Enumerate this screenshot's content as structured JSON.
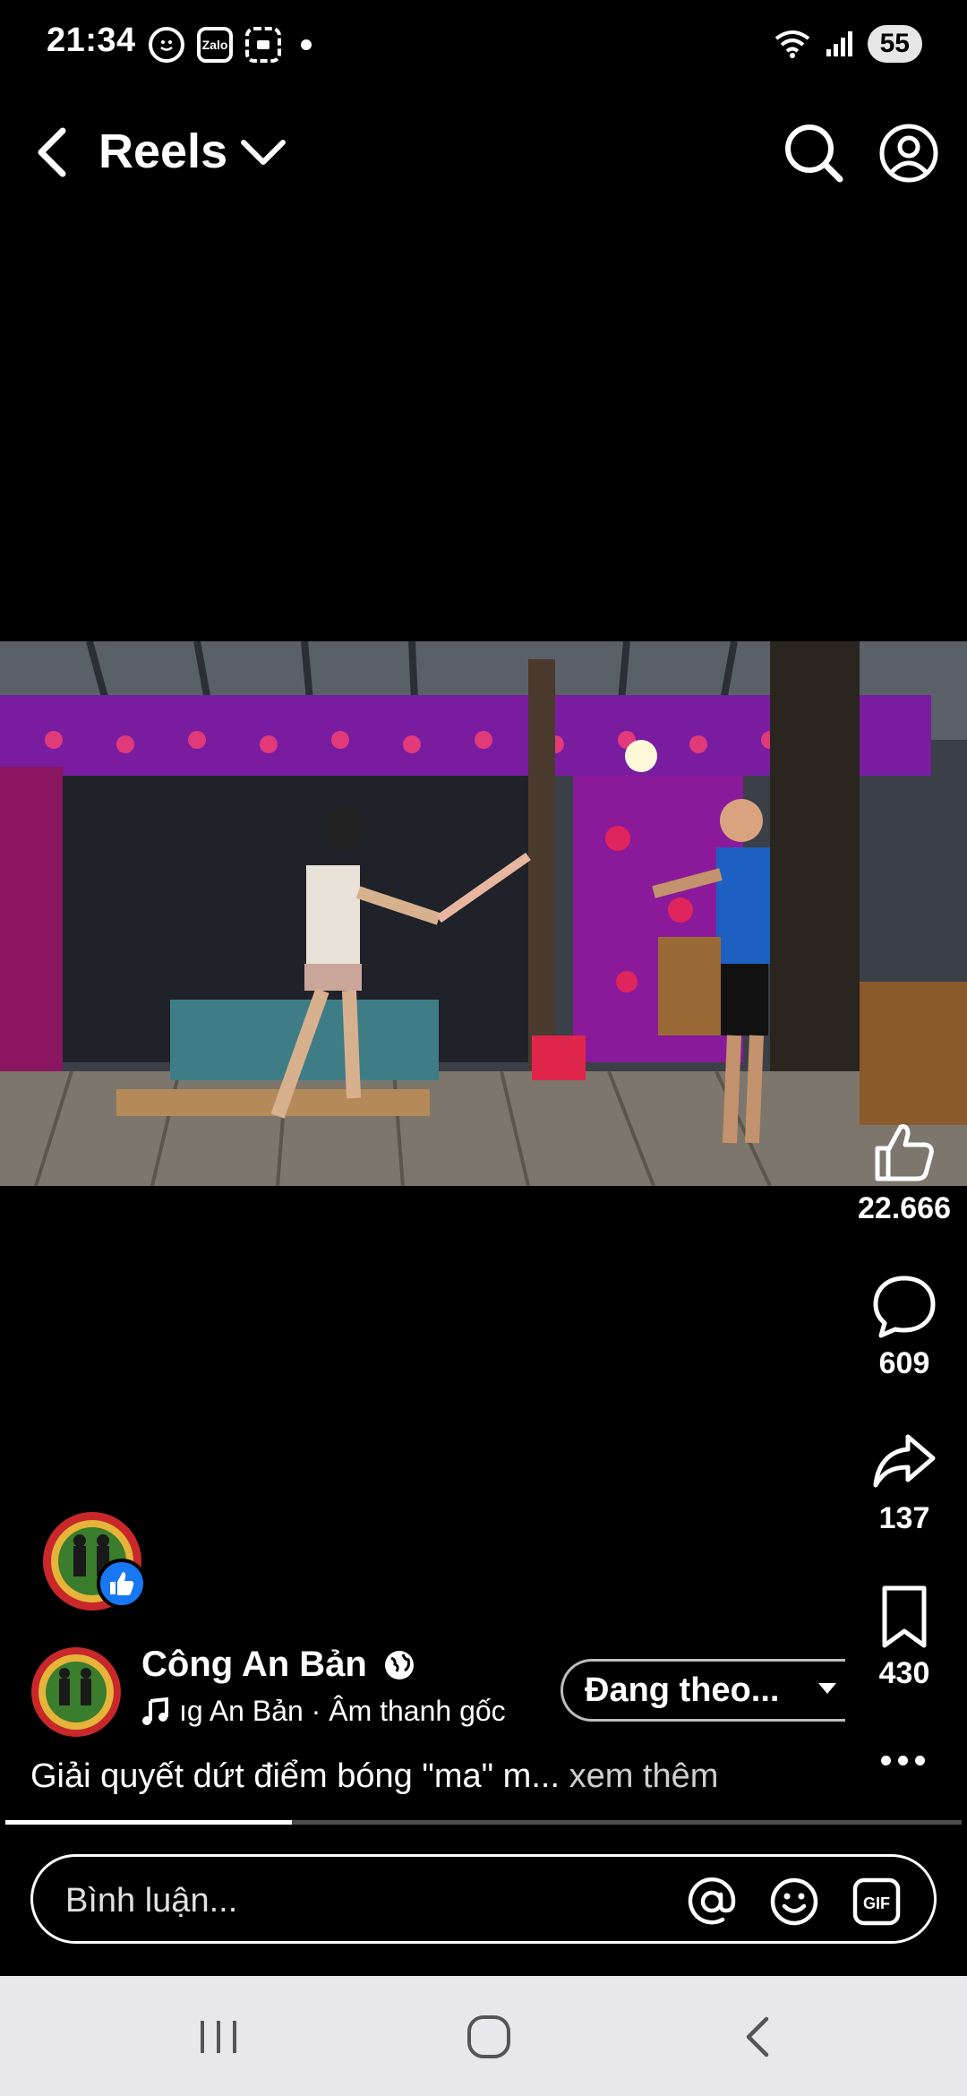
{
  "status_bar": {
    "time": "21:34",
    "left_icons": [
      "face-icon",
      "zalo-icon",
      "screenshot-icon",
      "dot-icon"
    ],
    "zalo_label": "Zalo",
    "battery": "55"
  },
  "header": {
    "title": "Reels",
    "icons": [
      "back-icon",
      "chevron-down-icon",
      "search-icon",
      "profile-icon"
    ]
  },
  "actions": {
    "likes": "22.666",
    "comments": "609",
    "shares": "137",
    "saves": "430"
  },
  "post": {
    "author": "Công An Bản",
    "audio": "ıg An Bản · Âm thanh gốc",
    "follow_label": "Đang theo...",
    "caption": "Giải quyết dứt điểm bóng \"ma\" m...",
    "see_more": "xem thêm",
    "progress": 0.3
  },
  "comment": {
    "placeholder": "Bình luận...",
    "icons": [
      "mention-icon",
      "emoji-icon",
      "gif-icon"
    ],
    "gif_label": "GIF"
  },
  "colors": {
    "accent": "#1877f2",
    "background": "#000000",
    "navbar": "#e8e8ec"
  }
}
